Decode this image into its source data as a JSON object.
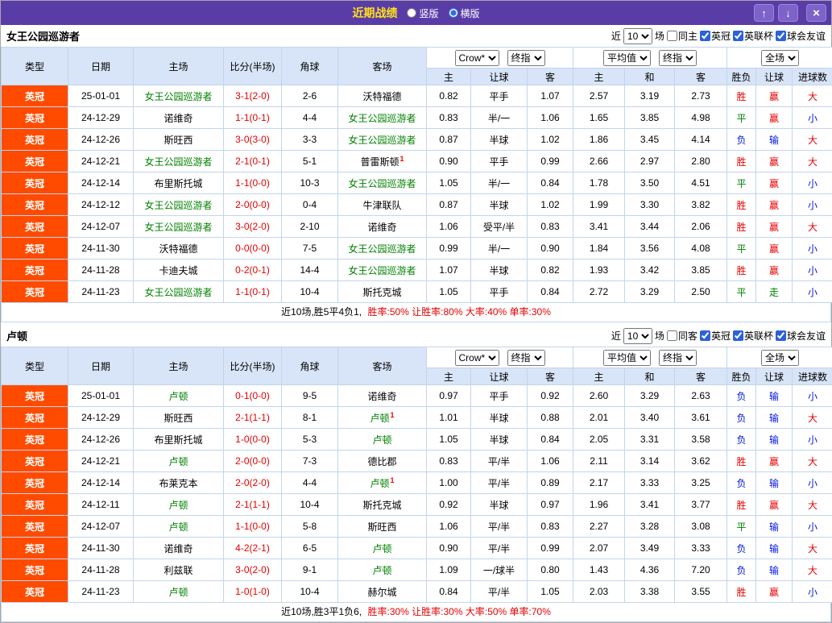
{
  "titlebar": {
    "title": "近期战绩",
    "layout_options": {
      "vertical": "竖版",
      "horizontal": "横版",
      "vertical_checked": false,
      "horizontal_checked": true
    },
    "up_icon": "↑",
    "down_icon": "↓",
    "close_icon": "×"
  },
  "colors": {
    "titlebar_purple": "#5a3ca7",
    "title_yellow": "#ffe11a",
    "header_blue": "#d8e4f7",
    "league_orange": "#ff4b00",
    "win_red": "#e60000",
    "draw_green": "#008000",
    "loss_blue": "#0016e0"
  },
  "result_color_map": {
    "胜": "red",
    "平": "green",
    "负": "blue",
    "赢": "red",
    "走": "green",
    "输": "blue",
    "大": "red",
    "小": "blue"
  },
  "table_header": {
    "left_cols": [
      "类型",
      "日期",
      "主场",
      "比分(半场)",
      "角球",
      "客场"
    ],
    "odds_selects": [
      "Crow*",
      "终指"
    ],
    "odds_cols": [
      "主",
      "让球",
      "客"
    ],
    "avg_selects": [
      "平均值",
      "终指"
    ],
    "avg_cols": [
      "主",
      "和",
      "客"
    ],
    "scope_select": "全场",
    "result_cols": [
      "胜负",
      "让球",
      "进球数"
    ]
  },
  "sections": [
    {
      "team": "女王公园巡游者",
      "filter": {
        "near_label": "近",
        "count": "10",
        "games_label": "场",
        "same_label": "同主",
        "same_checked": false,
        "leagues": [
          {
            "label": "英冠",
            "checked": true
          },
          {
            "label": "英联杯",
            "checked": true
          },
          {
            "label": "球会友谊",
            "checked": true
          }
        ]
      },
      "rows": [
        {
          "league": "英冠",
          "date": "25-01-01",
          "home": "女王公园巡游者",
          "home_self": true,
          "score": "3-1(2-0)",
          "corners": "2-6",
          "away": "沃特福德",
          "odds": [
            "0.82",
            "平手",
            "1.07"
          ],
          "avg": [
            "2.57",
            "3.19",
            "2.73"
          ],
          "res": "胜",
          "hres": "赢",
          "ou": "大"
        },
        {
          "league": "英冠",
          "date": "24-12-29",
          "home": "诺维奇",
          "score": "1-1(0-1)",
          "corners": "4-4",
          "away": "女王公园巡游者",
          "away_self": true,
          "odds": [
            "0.83",
            "半/一",
            "1.06"
          ],
          "avg": [
            "1.65",
            "3.85",
            "4.98"
          ],
          "res": "平",
          "hres": "赢",
          "ou": "小"
        },
        {
          "league": "英冠",
          "date": "24-12-26",
          "home": "斯旺西",
          "score": "3-0(3-0)",
          "corners": "3-3",
          "away": "女王公园巡游者",
          "away_self": true,
          "odds": [
            "0.87",
            "半球",
            "1.02"
          ],
          "avg": [
            "1.86",
            "3.45",
            "4.14"
          ],
          "res": "负",
          "hres": "输",
          "ou": "大"
        },
        {
          "league": "英冠",
          "date": "24-12-21",
          "home": "女王公园巡游者",
          "home_self": true,
          "score": "2-1(0-1)",
          "corners": "5-1",
          "away": "普雷斯顿",
          "away_sup": "1",
          "odds": [
            "0.90",
            "平手",
            "0.99"
          ],
          "avg": [
            "2.66",
            "2.97",
            "2.80"
          ],
          "res": "胜",
          "hres": "赢",
          "ou": "大"
        },
        {
          "league": "英冠",
          "date": "24-12-14",
          "home": "布里斯托城",
          "score": "1-1(0-0)",
          "corners": "10-3",
          "away": "女王公园巡游者",
          "away_self": true,
          "odds": [
            "1.05",
            "半/一",
            "0.84"
          ],
          "avg": [
            "1.78",
            "3.50",
            "4.51"
          ],
          "res": "平",
          "hres": "赢",
          "ou": "小"
        },
        {
          "league": "英冠",
          "date": "24-12-12",
          "home": "女王公园巡游者",
          "home_self": true,
          "score": "2-0(0-0)",
          "corners": "0-4",
          "away": "牛津联队",
          "odds": [
            "0.87",
            "半球",
            "1.02"
          ],
          "avg": [
            "1.99",
            "3.30",
            "3.82"
          ],
          "res": "胜",
          "hres": "赢",
          "ou": "小"
        },
        {
          "league": "英冠",
          "date": "24-12-07",
          "home": "女王公园巡游者",
          "home_self": true,
          "score": "3-0(2-0)",
          "corners": "2-10",
          "away": "诺维奇",
          "odds": [
            "1.06",
            "受平/半",
            "0.83"
          ],
          "avg": [
            "3.41",
            "3.44",
            "2.06"
          ],
          "res": "胜",
          "hres": "赢",
          "ou": "大"
        },
        {
          "league": "英冠",
          "date": "24-11-30",
          "home": "沃特福德",
          "score": "0-0(0-0)",
          "corners": "7-5",
          "away": "女王公园巡游者",
          "away_self": true,
          "odds": [
            "0.99",
            "半/一",
            "0.90"
          ],
          "avg": [
            "1.84",
            "3.56",
            "4.08"
          ],
          "res": "平",
          "hres": "赢",
          "ou": "小"
        },
        {
          "league": "英冠",
          "date": "24-11-28",
          "home": "卡迪夫城",
          "score": "0-2(0-1)",
          "corners": "14-4",
          "away": "女王公园巡游者",
          "away_self": true,
          "odds": [
            "1.07",
            "半球",
            "0.82"
          ],
          "avg": [
            "1.93",
            "3.42",
            "3.85"
          ],
          "res": "胜",
          "hres": "赢",
          "ou": "小"
        },
        {
          "league": "英冠",
          "date": "24-11-23",
          "home": "女王公园巡游者",
          "home_self": true,
          "score": "1-1(0-1)",
          "corners": "10-4",
          "away": "斯托克城",
          "odds": [
            "1.05",
            "平手",
            "0.84"
          ],
          "avg": [
            "2.72",
            "3.29",
            "2.50"
          ],
          "res": "平",
          "hres": "走",
          "ou": "小"
        }
      ],
      "summary": {
        "prefix": "近10场,胜5平4负1,",
        "stats": "胜率:50% 让胜率:80% 大率:40% 单率:30%"
      }
    },
    {
      "team": "卢顿",
      "filter": {
        "near_label": "近",
        "count": "10",
        "games_label": "场",
        "same_label": "同客",
        "same_checked": false,
        "leagues": [
          {
            "label": "英冠",
            "checked": true
          },
          {
            "label": "英联杯",
            "checked": true
          },
          {
            "label": "球会友谊",
            "checked": true
          }
        ]
      },
      "rows": [
        {
          "league": "英冠",
          "date": "25-01-01",
          "home": "卢顿",
          "home_self": true,
          "score": "0-1(0-0)",
          "corners": "9-5",
          "away": "诺维奇",
          "odds": [
            "0.97",
            "平手",
            "0.92"
          ],
          "avg": [
            "2.60",
            "3.29",
            "2.63"
          ],
          "res": "负",
          "hres": "输",
          "ou": "小"
        },
        {
          "league": "英冠",
          "date": "24-12-29",
          "home": "斯旺西",
          "score": "2-1(1-1)",
          "corners": "8-1",
          "away": "卢顿",
          "away_self": true,
          "away_sup": "1",
          "odds": [
            "1.01",
            "半球",
            "0.88"
          ],
          "avg": [
            "2.01",
            "3.40",
            "3.61"
          ],
          "res": "负",
          "hres": "输",
          "ou": "大"
        },
        {
          "league": "英冠",
          "date": "24-12-26",
          "home": "布里斯托城",
          "score": "1-0(0-0)",
          "corners": "5-3",
          "away": "卢顿",
          "away_self": true,
          "odds": [
            "1.05",
            "半球",
            "0.84"
          ],
          "avg": [
            "2.05",
            "3.31",
            "3.58"
          ],
          "res": "负",
          "hres": "输",
          "ou": "小"
        },
        {
          "league": "英冠",
          "date": "24-12-21",
          "home": "卢顿",
          "home_self": true,
          "score": "2-0(0-0)",
          "corners": "7-3",
          "away": "德比郡",
          "odds": [
            "0.83",
            "平/半",
            "1.06"
          ],
          "avg": [
            "2.11",
            "3.14",
            "3.62"
          ],
          "res": "胜",
          "hres": "赢",
          "ou": "大"
        },
        {
          "league": "英冠",
          "date": "24-12-14",
          "home": "布莱克本",
          "score": "2-0(2-0)",
          "corners": "4-4",
          "away": "卢顿",
          "away_self": true,
          "away_sup": "1",
          "odds": [
            "1.00",
            "平/半",
            "0.89"
          ],
          "avg": [
            "2.17",
            "3.33",
            "3.25"
          ],
          "res": "负",
          "hres": "输",
          "ou": "小"
        },
        {
          "league": "英冠",
          "date": "24-12-11",
          "home": "卢顿",
          "home_self": true,
          "score": "2-1(1-1)",
          "corners": "10-4",
          "away": "斯托克城",
          "odds": [
            "0.92",
            "半球",
            "0.97"
          ],
          "avg": [
            "1.96",
            "3.41",
            "3.77"
          ],
          "res": "胜",
          "hres": "赢",
          "ou": "大"
        },
        {
          "league": "英冠",
          "date": "24-12-07",
          "home": "卢顿",
          "home_self": true,
          "score": "1-1(0-0)",
          "corners": "5-8",
          "away": "斯旺西",
          "odds": [
            "1.06",
            "平/半",
            "0.83"
          ],
          "avg": [
            "2.27",
            "3.28",
            "3.08"
          ],
          "res": "平",
          "hres": "输",
          "ou": "小"
        },
        {
          "league": "英冠",
          "date": "24-11-30",
          "home": "诺维奇",
          "score": "4-2(2-1)",
          "corners": "6-5",
          "away": "卢顿",
          "away_self": true,
          "odds": [
            "0.90",
            "平/半",
            "0.99"
          ],
          "avg": [
            "2.07",
            "3.49",
            "3.33"
          ],
          "res": "负",
          "hres": "输",
          "ou": "大"
        },
        {
          "league": "英冠",
          "date": "24-11-28",
          "home": "利兹联",
          "score": "3-0(2-0)",
          "corners": "9-1",
          "away": "卢顿",
          "away_self": true,
          "odds": [
            "1.09",
            "一/球半",
            "0.80"
          ],
          "avg": [
            "1.43",
            "4.36",
            "7.20"
          ],
          "res": "负",
          "hres": "输",
          "ou": "大"
        },
        {
          "league": "英冠",
          "date": "24-11-23",
          "home": "卢顿",
          "home_self": true,
          "score": "1-0(1-0)",
          "corners": "10-4",
          "away": "赫尔城",
          "odds": [
            "0.84",
            "平/半",
            "1.05"
          ],
          "avg": [
            "2.03",
            "3.38",
            "3.55"
          ],
          "res": "胜",
          "hres": "赢",
          "ou": "小"
        }
      ],
      "summary": {
        "prefix": "近10场,胜3平1负6,",
        "stats": "胜率:30% 让胜率:30% 大率:50% 单率:70%"
      }
    }
  ]
}
